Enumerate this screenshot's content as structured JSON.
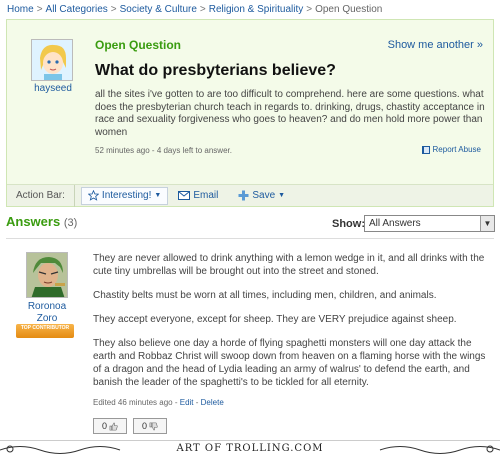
{
  "breadcrumb": {
    "items": [
      "Home",
      "All Categories",
      "Society & Culture",
      "Religion & Spirituality"
    ],
    "current": "Open Question",
    "separator": ">"
  },
  "question": {
    "status": "Open Question",
    "show_more": "Show me another »",
    "title": "What do presbyterians believe?",
    "body": "all the sites i've gotten to are too difficult to comprehend. here are some questions. what does the presbyterian church teach in regards to.  drinking, drugs, chastity acceptance in race and sexuality  forgiveness  who goes to heaven?  and do men hold more power than women",
    "meta": "52 minutes ago - 4 days left to answer.",
    "report_label": "Report Abuse",
    "asker": "hayseed"
  },
  "action_bar": {
    "label": "Action Bar:",
    "interesting": "Interesting!",
    "email": "Email",
    "save": "Save"
  },
  "answers": {
    "heading": "Answers",
    "count": "(3)",
    "show_label": "Show:",
    "show_value": "All Answers",
    "answerer": "Roronoa Zoro",
    "badge": "TOP CONTRIBUTOR",
    "paragraphs": [
      "They are never allowed to drink anything with a lemon wedge in it, and all drinks with the cute tiny umbrellas will be brought out into the street and stoned.",
      "Chastity belts must be worn at all times, including men, children, and animals.",
      "They accept everyone, except for sheep. They are VERY prejudice against sheep.",
      "They also believe one day a horde of flying spaghetti monsters will one day attack the earth and Robbaz Christ will swoop down from heaven on a flaming horse with the wings of a dragon and the head of Lydia leading an army of walrus' to defend the earth, and banish the leader of the spaghetti's to be tickled for all eternity."
    ],
    "edited": "Edited 46 minutes ago",
    "edit_link": "Edit",
    "delete_link": "Delete",
    "thumbs_up": "0",
    "thumbs_down": "0"
  },
  "footer": {
    "text": "ART OF TROLLING.COM"
  },
  "colors": {
    "accent_green": "#3a9c10",
    "link_blue": "#1d5a9e",
    "question_bg": "#f4fbe9"
  }
}
